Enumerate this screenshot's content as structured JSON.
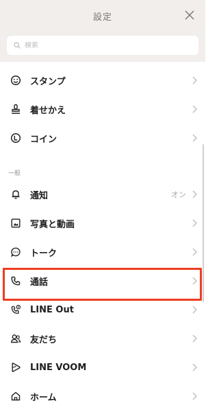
{
  "header": {
    "title": "設定",
    "search_placeholder": "検索"
  },
  "items_top": [
    {
      "label": "スタンプ",
      "icon": "smiley-icon"
    },
    {
      "label": "着せかえ",
      "icon": "stamp-brush-icon"
    },
    {
      "label": "コイン",
      "icon": "coin-icon"
    }
  ],
  "section_general": "一般",
  "items_general": [
    {
      "label": "通知",
      "icon": "bell-icon",
      "value": "オン"
    },
    {
      "label": "写真と動画",
      "icon": "photo-icon"
    },
    {
      "label": "トーク",
      "icon": "chat-bubble-icon"
    },
    {
      "label": "通話",
      "icon": "phone-icon"
    },
    {
      "label": "LINE Out",
      "icon": "phone-out-icon"
    },
    {
      "label": "友だち",
      "icon": "friends-icon"
    },
    {
      "label": "LINE VOOM",
      "icon": "voom-play-icon"
    },
    {
      "label": "ホーム",
      "icon": "home-icon"
    }
  ],
  "colors": {
    "header_bg": "#f1eeec",
    "highlight": "#ee3d21",
    "text": "#1e1e1e",
    "muted": "#aaaaaa"
  }
}
